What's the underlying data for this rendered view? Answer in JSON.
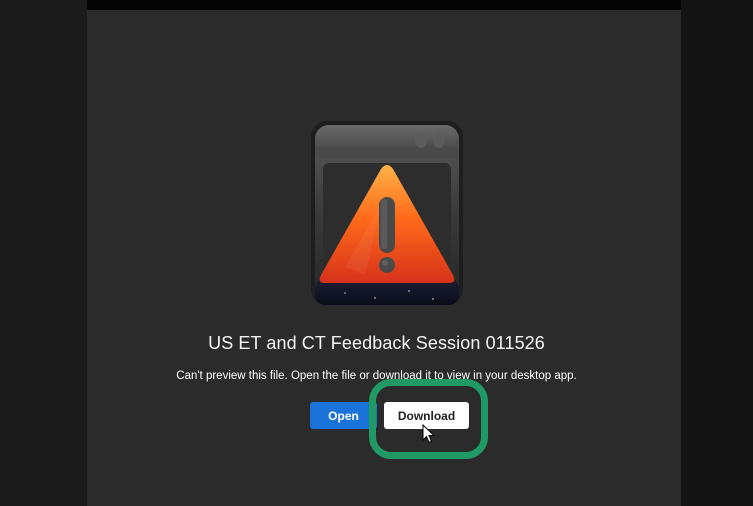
{
  "file": {
    "title": "US ET and CT Feedback Session 011526",
    "message": "Can't preview this file. Open the file or download it to view in your desktop app."
  },
  "actions": {
    "open_label": "Open",
    "download_label": "Download"
  },
  "icons": {
    "warning": "warning-window-icon",
    "cursor": "mouse-pointer-icon"
  },
  "colors": {
    "panel": "#2b2b2b",
    "open_button": "#1a73d8",
    "download_button": "#ffffff",
    "highlight": "#1f9a64"
  }
}
